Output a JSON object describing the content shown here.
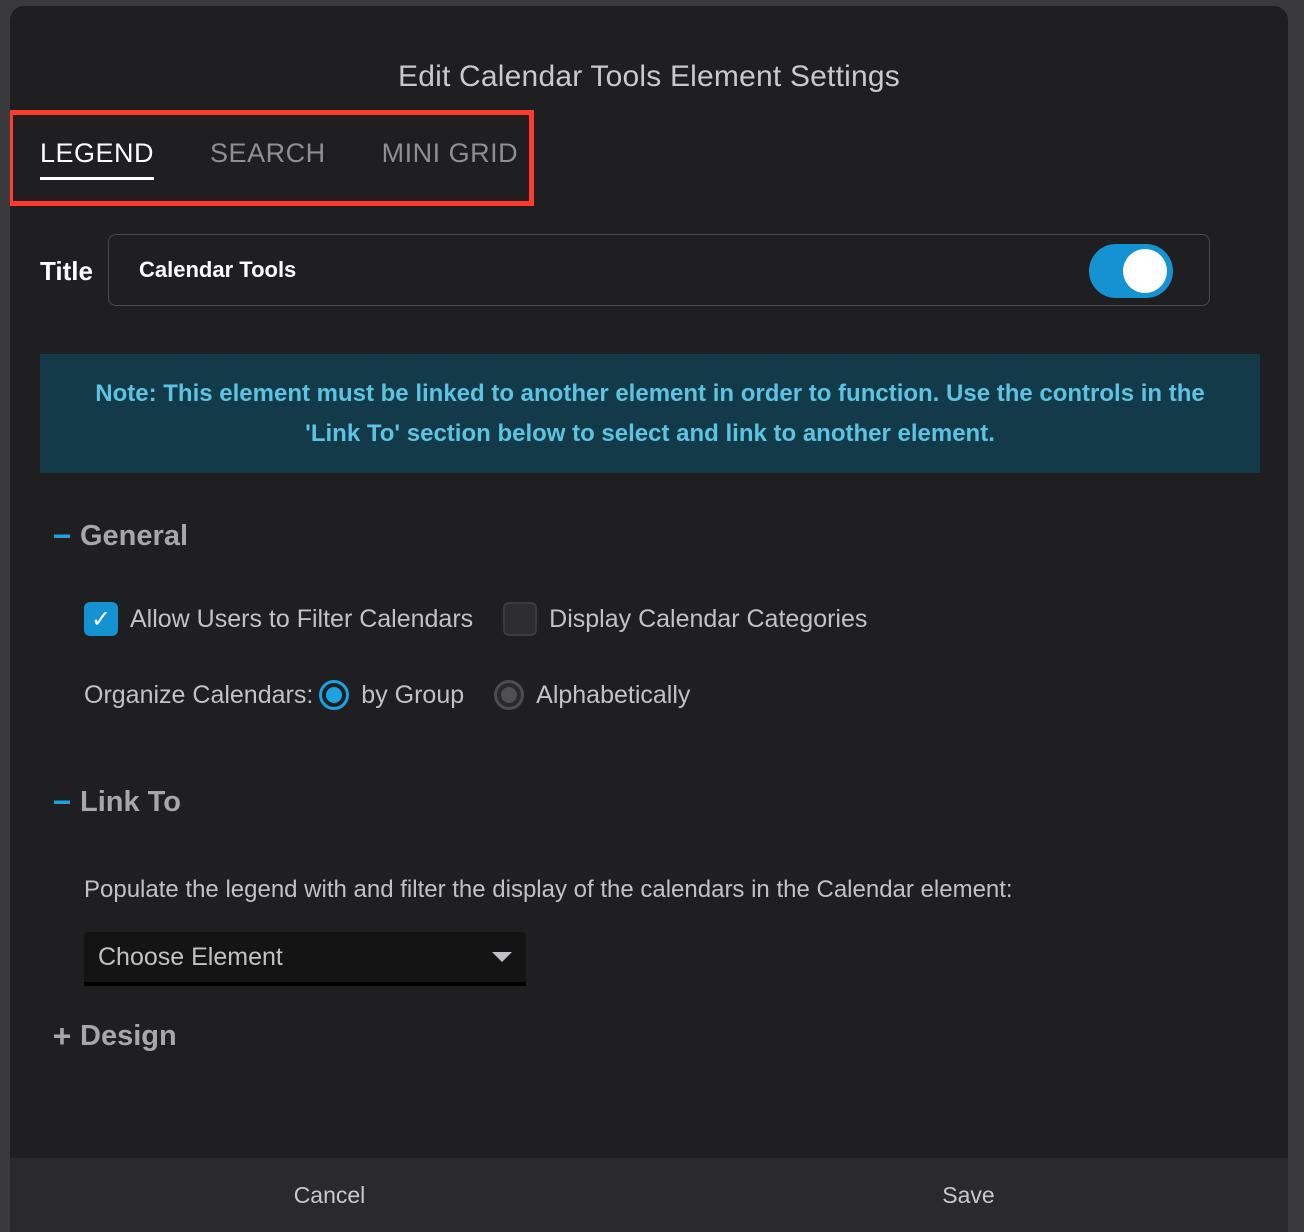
{
  "dialog": {
    "title": "Edit Calendar Tools Element Settings"
  },
  "tabs": [
    {
      "label": "LEGEND",
      "active": true
    },
    {
      "label": "SEARCH",
      "active": false
    },
    {
      "label": "MINI GRID",
      "active": false
    }
  ],
  "title_field": {
    "label": "Title",
    "value": "Calendar Tools",
    "toggle_on": true
  },
  "note": {
    "text": "Note: This element must be linked to another element in order to function. Use the controls in the 'Link To' section below to select and link to another element."
  },
  "general": {
    "header": "General",
    "expanded": true,
    "checkboxes": [
      {
        "label": "Allow Users to Filter Calendars",
        "checked": true
      },
      {
        "label": "Display Calendar Categories",
        "checked": false
      }
    ],
    "organize_label": "Organize Calendars:",
    "radios": [
      {
        "label": "by Group",
        "selected": true
      },
      {
        "label": "Alphabetically",
        "selected": false
      }
    ]
  },
  "link_to": {
    "header": "Link To",
    "expanded": true,
    "description": "Populate the legend with and filter the display of the calendars in the Calendar element:",
    "dropdown_value": "Choose Element"
  },
  "design": {
    "header": "Design",
    "expanded": false
  },
  "footer": {
    "cancel_label": "Cancel",
    "save_label": "Save"
  },
  "colors": {
    "accent": "#1592d1",
    "highlight": "#ff3b2f",
    "note_bg": "#133a48",
    "note_text": "#5cc4e2"
  }
}
